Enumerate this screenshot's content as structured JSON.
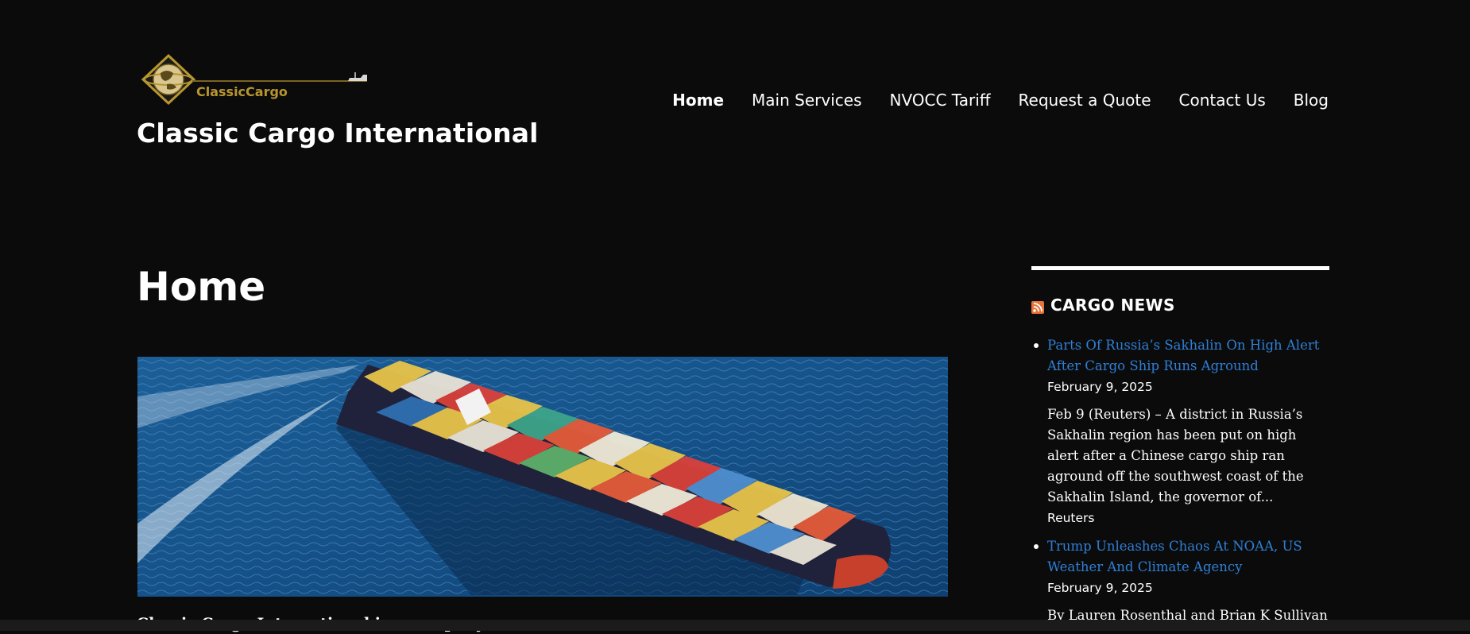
{
  "logo": {
    "text": "ClassicCargo"
  },
  "site_title": "Classic Cargo International",
  "nav": {
    "items": [
      {
        "label": "Home",
        "active": true
      },
      {
        "label": "Main Services"
      },
      {
        "label": "NVOCC Tariff"
      },
      {
        "label": "Request a Quote"
      },
      {
        "label": "Contact Us"
      },
      {
        "label": "Blog"
      }
    ]
  },
  "main": {
    "page_heading": "Home",
    "teaser_text": "Classic Cargo International is a company ... ... ..."
  },
  "sidebar": {
    "widget_title": "CARGO NEWS",
    "rss_icon": "rss-feed-icon",
    "news": [
      {
        "title": "Parts Of Russia’s Sakhalin On High Alert After Cargo Ship Runs Aground",
        "date": "February 9, 2025",
        "excerpt": "Feb 9 (Reuters) – A district in Russia’s Sakhalin region has been put on high alert after a Chinese cargo ship ran aground off the southwest coast of the Sakhalin Island, the governor of...",
        "source": "Reuters"
      },
      {
        "title": "Trump Unleashes Chaos At NOAA, US Weather And Climate Agency",
        "date": "February 9, 2025",
        "excerpt": "By Lauren Rosenthal and Brian K Sullivan",
        "source": ""
      }
    ]
  },
  "colors": {
    "background": "#0b0b0b",
    "text": "#ffffff",
    "link": "#2f7fd7",
    "logo_gold": "#b8962e",
    "rss": "#e8733a"
  }
}
